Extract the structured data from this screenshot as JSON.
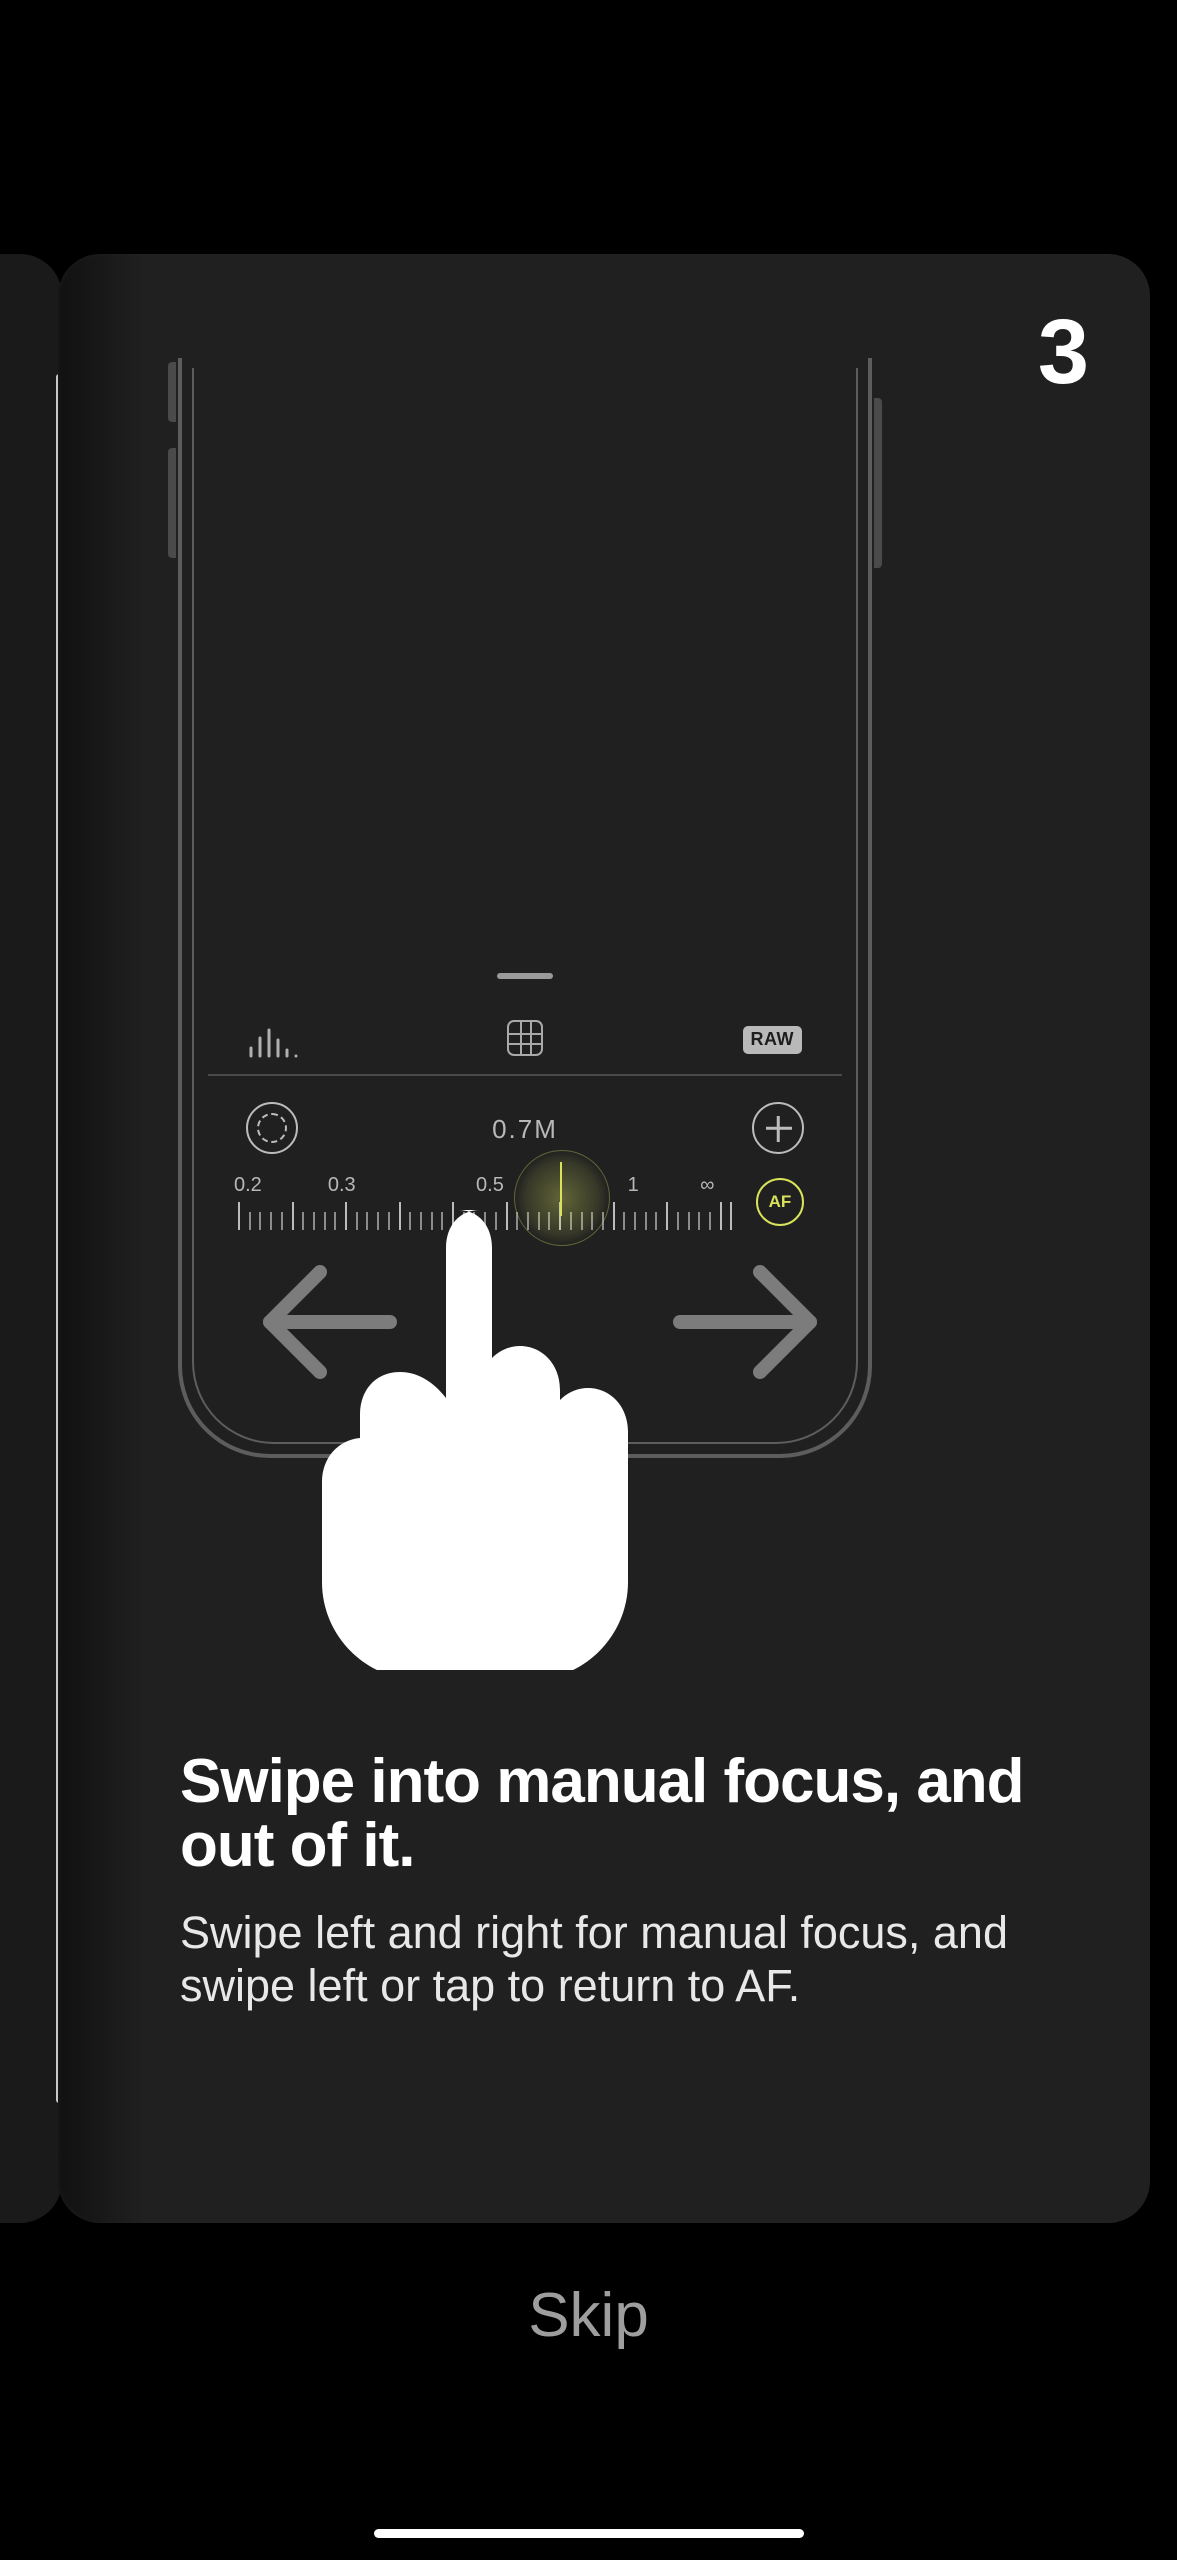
{
  "step_number": "3",
  "headline": "Swipe into manual focus, and out of it.",
  "body": "Swipe left and right for manual focus, and swipe left or tap to return to AF.",
  "skip_label": "Skip",
  "camera_ui": {
    "raw_badge": "RAW",
    "focus_distance": "0.7M",
    "af_label": "AF",
    "ruler_labels": [
      "0.2",
      "0.3",
      "0.5",
      "1",
      "∞"
    ],
    "ruler_positions_pct": [
      2,
      21,
      51,
      80,
      95
    ]
  },
  "colors": {
    "card_bg": "#202020",
    "accent": "#d8e35a",
    "line": "#a9a9a9"
  }
}
